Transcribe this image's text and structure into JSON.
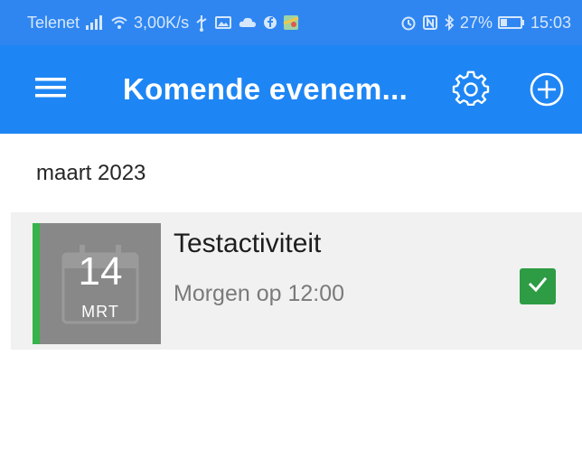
{
  "status_bar": {
    "carrier": "Telenet",
    "speed": "3,00K/s",
    "battery_percent": "27%",
    "time": "15:03",
    "icons": [
      "signal-icon",
      "wifi-icon",
      "usb-icon",
      "photo-icon",
      "cloud-icon",
      "facebook-icon",
      "maps-icon",
      "alarm-icon",
      "nfc-icon",
      "bluetooth-icon",
      "battery-icon"
    ]
  },
  "app_bar": {
    "title": "Komende evenem...",
    "menu_icon": "menu-icon",
    "settings_icon": "gear-icon",
    "add_icon": "plus-circle-icon",
    "color": "#1e86f4"
  },
  "events": {
    "month_header": "maart 2023",
    "items": [
      {
        "day": "14",
        "month": "MRT",
        "title": "Testactiviteit",
        "time": "Morgen op 12:00",
        "accent_color": "#36b34a",
        "checked": true
      }
    ]
  }
}
